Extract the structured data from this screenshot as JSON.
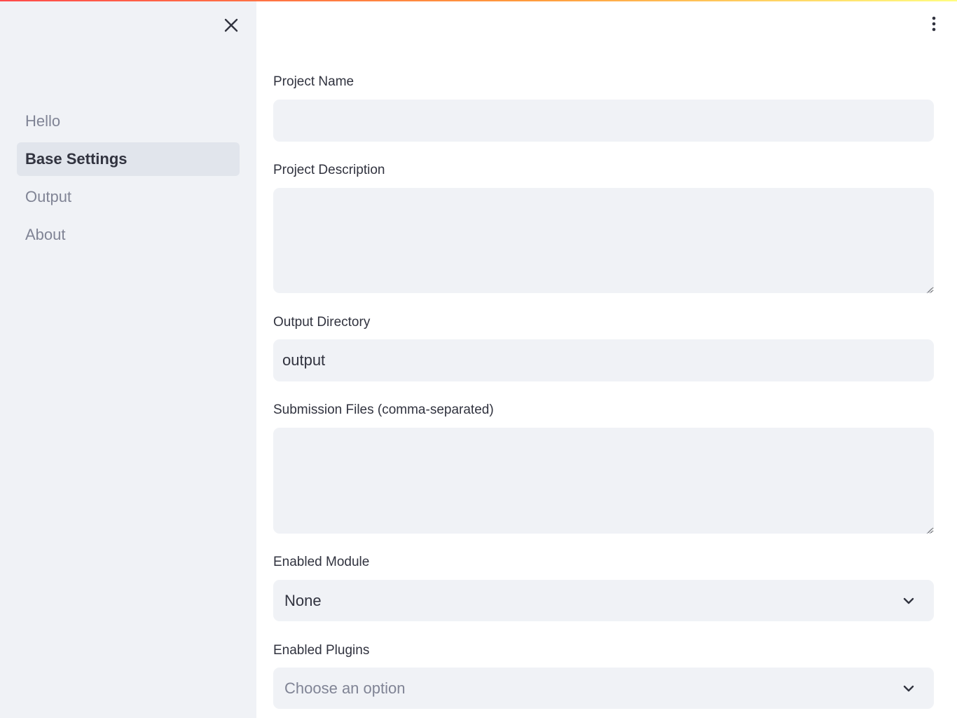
{
  "sidebar": {
    "close_icon": "close-icon",
    "items": [
      {
        "label": "Hello",
        "active": false
      },
      {
        "label": "Base Settings",
        "active": true
      },
      {
        "label": "Output",
        "active": false
      },
      {
        "label": "About",
        "active": false
      }
    ]
  },
  "header": {
    "menu_icon": "kebab-menu-icon"
  },
  "form": {
    "project_name": {
      "label": "Project Name",
      "value": ""
    },
    "project_description": {
      "label": "Project Description",
      "value": ""
    },
    "output_directory": {
      "label": "Output Directory",
      "value": "output"
    },
    "submission_files": {
      "label": "Submission Files (comma-separated)",
      "value": ""
    },
    "enabled_module": {
      "label": "Enabled Module",
      "value": "None"
    },
    "enabled_plugins": {
      "label": "Enabled Plugins",
      "placeholder": "Choose an option"
    }
  },
  "colors": {
    "accent_red": "#ff4b4b",
    "sidebar_bg": "#f0f2f6",
    "input_bg": "#f0f2f6",
    "text": "#31333f",
    "muted_text": "#808495"
  }
}
